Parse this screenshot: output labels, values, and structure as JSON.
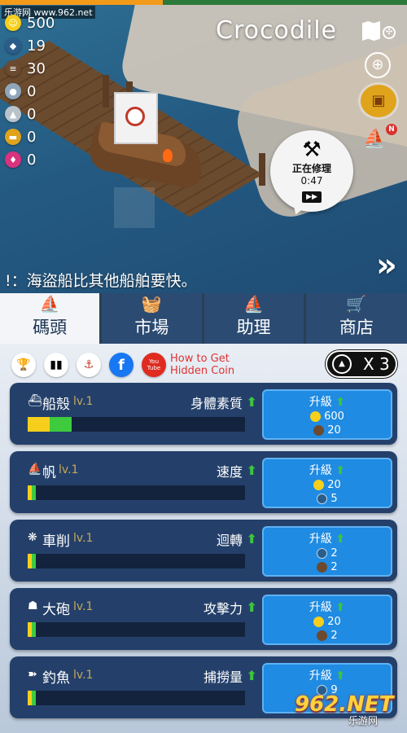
{
  "watermark": "乐游网 www.962.net",
  "resources": [
    {
      "icon": "coin-icon",
      "value": "500",
      "color": "#f6cf1d"
    },
    {
      "icon": "fish-icon",
      "value": "19",
      "color": "#2b5c8a"
    },
    {
      "icon": "wood-icon",
      "value": "30",
      "color": "#6b4a2f"
    },
    {
      "icon": "iron-icon",
      "value": "0",
      "color": "#8fa6bb"
    },
    {
      "icon": "stone-icon",
      "value": "0",
      "color": "#b9c3cc"
    },
    {
      "icon": "gold-bar-icon",
      "value": "0",
      "color": "#e0a31c"
    },
    {
      "icon": "gem-icon",
      "value": "0",
      "color": "#d9327f"
    }
  ],
  "ship_name": "Crocodile",
  "repair": {
    "label": "正在修理",
    "time": "0:47"
  },
  "fleet_badge": "N",
  "tip": "!：海盜船比其他船舶要快。",
  "more_icon": "»",
  "tabs": [
    {
      "label": "碼頭",
      "icon": "sail-icon",
      "active": true
    },
    {
      "label": "市場",
      "icon": "basket-icon",
      "active": false
    },
    {
      "label": "助理",
      "icon": "fleet-icon",
      "active": false
    },
    {
      "label": "商店",
      "icon": "cart-icon",
      "active": false
    }
  ],
  "social": {
    "hidden_coin_line1": "How to Get",
    "hidden_coin_line2": "Hidden Coin",
    "youtube_text": "You Tube",
    "facebook_text": "f"
  },
  "multiplier": "X 3",
  "upgrades": [
    {
      "name": "船殼",
      "level": "lv.1",
      "stat": "身體素質",
      "bar": {
        "yellow": 0.1,
        "green": 0.1
      },
      "button": "升級",
      "costs": [
        {
          "type": "coin",
          "amount": "600"
        },
        {
          "type": "wood",
          "amount": "20"
        }
      ]
    },
    {
      "name": "帆",
      "level": "lv.1",
      "stat": "速度",
      "bar": {
        "yellow": 0.02,
        "green": 0.02
      },
      "button": "升級",
      "costs": [
        {
          "type": "coin",
          "amount": "20"
        },
        {
          "type": "fish",
          "amount": "5"
        }
      ]
    },
    {
      "name": "車削",
      "level": "lv.1",
      "stat": "迴轉",
      "bar": {
        "yellow": 0.02,
        "green": 0.02
      },
      "button": "升級",
      "costs": [
        {
          "type": "fish",
          "amount": "2"
        },
        {
          "type": "wood",
          "amount": "2"
        }
      ]
    },
    {
      "name": "大砲",
      "level": "lv.1",
      "stat": "攻擊力",
      "bar": {
        "yellow": 0.02,
        "green": 0.02
      },
      "button": "升級",
      "costs": [
        {
          "type": "coin",
          "amount": "20"
        },
        {
          "type": "wood",
          "amount": "2"
        }
      ]
    },
    {
      "name": "釣魚",
      "level": "lv.1",
      "stat": "捕撈量",
      "bar": {
        "yellow": 0.02,
        "green": 0.02
      },
      "button": "升級",
      "costs": [
        {
          "type": "fish",
          "amount": "9"
        }
      ]
    }
  ],
  "logo": {
    "big": "962.NET",
    "small": "乐游网"
  }
}
